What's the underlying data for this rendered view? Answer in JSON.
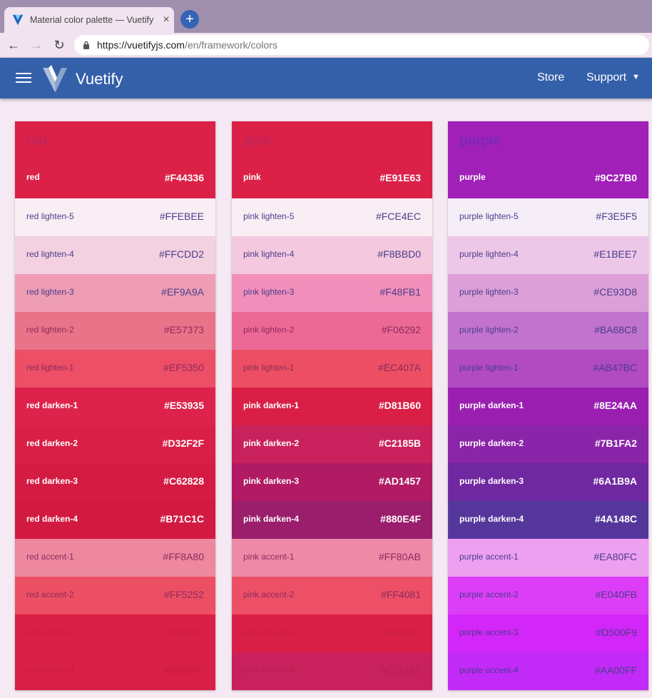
{
  "browser": {
    "tab_title": "Material color palette — Vuetify",
    "tab_close": "×",
    "new_tab": "+",
    "url_host": "https://vuetifyjs.com",
    "url_path": "/en/framework/colors",
    "back_icon": "←",
    "forward_icon": "→",
    "reload_icon": "↻"
  },
  "appbar": {
    "brand": "Vuetify",
    "store": "Store",
    "support": "Support",
    "caret": "▼"
  },
  "colors": {
    "brand_bar": "#3460aa",
    "page_bg": "#f5e9f3"
  },
  "palettes": [
    {
      "name": "red",
      "base_label": "red",
      "base_hex": "#F44336",
      "header_color": "#dc2148",
      "swatches": [
        {
          "label": "red lighten-5",
          "hex": "#FFEBEE",
          "color": "#f8eef4",
          "tone": "light"
        },
        {
          "label": "red lighten-4",
          "hex": "#FFCDD2",
          "color": "#f4d1e0",
          "tone": "light"
        },
        {
          "label": "red lighten-3",
          "hex": "#EF9A9A",
          "color": "#ee9db4",
          "tone": "light"
        },
        {
          "label": "red lighten-2",
          "hex": "#E57373",
          "color": "#e97389",
          "tone": "dimtext"
        },
        {
          "label": "red lighten-1",
          "hex": "#EF5350",
          "color": "#ec4f66",
          "tone": "dimtext"
        },
        {
          "label": "red darken-1",
          "hex": "#E53935",
          "color": "#dd234b",
          "tone": "dark"
        },
        {
          "label": "red darken-2",
          "hex": "#D32F2F",
          "color": "#d91f45",
          "tone": "dark"
        },
        {
          "label": "red darken-3",
          "hex": "#C62828",
          "color": "#d41c43",
          "tone": "dark"
        },
        {
          "label": "red darken-4",
          "hex": "#B71C1C",
          "color": "#d21a40",
          "tone": "dark"
        },
        {
          "label": "red accent-1",
          "hex": "#FF8A80",
          "color": "#ee889f",
          "tone": "dimtext"
        },
        {
          "label": "red accent-2",
          "hex": "#FF5252",
          "color": "#ec4f63",
          "tone": "dimtext"
        },
        {
          "label": "red accent-3",
          "hex": "#FF1744",
          "color": "#d91f45",
          "tone": "faded"
        },
        {
          "label": "red accent-4",
          "hex": "#D50000",
          "color": "#d91f45",
          "tone": "faded"
        }
      ]
    },
    {
      "name": "pink",
      "base_label": "pink",
      "base_hex": "#E91E63",
      "header_color": "#dc2148",
      "swatches": [
        {
          "label": "pink lighten-5",
          "hex": "#FCE4EC",
          "color": "#f8eef4",
          "tone": "light"
        },
        {
          "label": "pink lighten-4",
          "hex": "#F8BBD0",
          "color": "#f4c8de",
          "tone": "light"
        },
        {
          "label": "pink lighten-3",
          "hex": "#F48FB1",
          "color": "#f18fba",
          "tone": "light"
        },
        {
          "label": "pink lighten-2",
          "hex": "#F06292",
          "color": "#ec6996",
          "tone": "dimtext"
        },
        {
          "label": "pink lighten-1",
          "hex": "#EC407A",
          "color": "#ec4f63",
          "tone": "dimtext"
        },
        {
          "label": "pink darken-1",
          "hex": "#D81B60",
          "color": "#d91f45",
          "tone": "dark"
        },
        {
          "label": "pink darken-2",
          "hex": "#C2185B",
          "color": "#c9215c",
          "tone": "dark"
        },
        {
          "label": "pink darken-3",
          "hex": "#AD1457",
          "color": "#b01b63",
          "tone": "dark"
        },
        {
          "label": "pink darken-4",
          "hex": "#880E4F",
          "color": "#9a1e6b",
          "tone": "dark"
        },
        {
          "label": "pink accent-1",
          "hex": "#FF80AB",
          "color": "#ee89a8",
          "tone": "dimtext"
        },
        {
          "label": "pink accent-2",
          "hex": "#FF4081",
          "color": "#ec4f66",
          "tone": "dimtext"
        },
        {
          "label": "pink accent-3",
          "hex": "#F50057",
          "color": "#d91f45",
          "tone": "faded"
        },
        {
          "label": "pink accent-4",
          "hex": "#C51162",
          "color": "#c9215c",
          "tone": "faded"
        }
      ]
    },
    {
      "name": "purple",
      "base_label": "purple",
      "base_hex": "#9C27B0",
      "header_color": "#a020b8",
      "swatches": [
        {
          "label": "purple lighten-5",
          "hex": "#F3E5F5",
          "color": "#f5edf7",
          "tone": "light"
        },
        {
          "label": "purple lighten-4",
          "hex": "#E1BEE7",
          "color": "#ecc7e8",
          "tone": "light"
        },
        {
          "label": "purple lighten-3",
          "hex": "#CE93D8",
          "color": "#dc9fd8",
          "tone": "light"
        },
        {
          "label": "purple lighten-2",
          "hex": "#BA68C8",
          "color": "#c173cd",
          "tone": "light"
        },
        {
          "label": "purple lighten-1",
          "hex": "#AB47BC",
          "color": "#b24ac2",
          "tone": "light"
        },
        {
          "label": "purple darken-1",
          "hex": "#8E24AA",
          "color": "#9a1fb1",
          "tone": "dark"
        },
        {
          "label": "purple darken-2",
          "hex": "#7B1FA2",
          "color": "#8a24a8",
          "tone": "dark"
        },
        {
          "label": "purple darken-3",
          "hex": "#6A1B9A",
          "color": "#6f28a0",
          "tone": "dark"
        },
        {
          "label": "purple darken-4",
          "hex": "#4A148C",
          "color": "#55379c",
          "tone": "dark"
        },
        {
          "label": "purple accent-1",
          "hex": "#EA80FC",
          "color": "#ed9ff0",
          "tone": "light"
        },
        {
          "label": "purple accent-2",
          "hex": "#E040FB",
          "color": "#dc3ef7",
          "tone": "light"
        },
        {
          "label": "purple accent-3",
          "hex": "#D500F9",
          "color": "#d326f8",
          "tone": "light"
        },
        {
          "label": "purple accent-4",
          "hex": "#AA00FF",
          "color": "#c22af8",
          "tone": "light"
        }
      ]
    }
  ]
}
